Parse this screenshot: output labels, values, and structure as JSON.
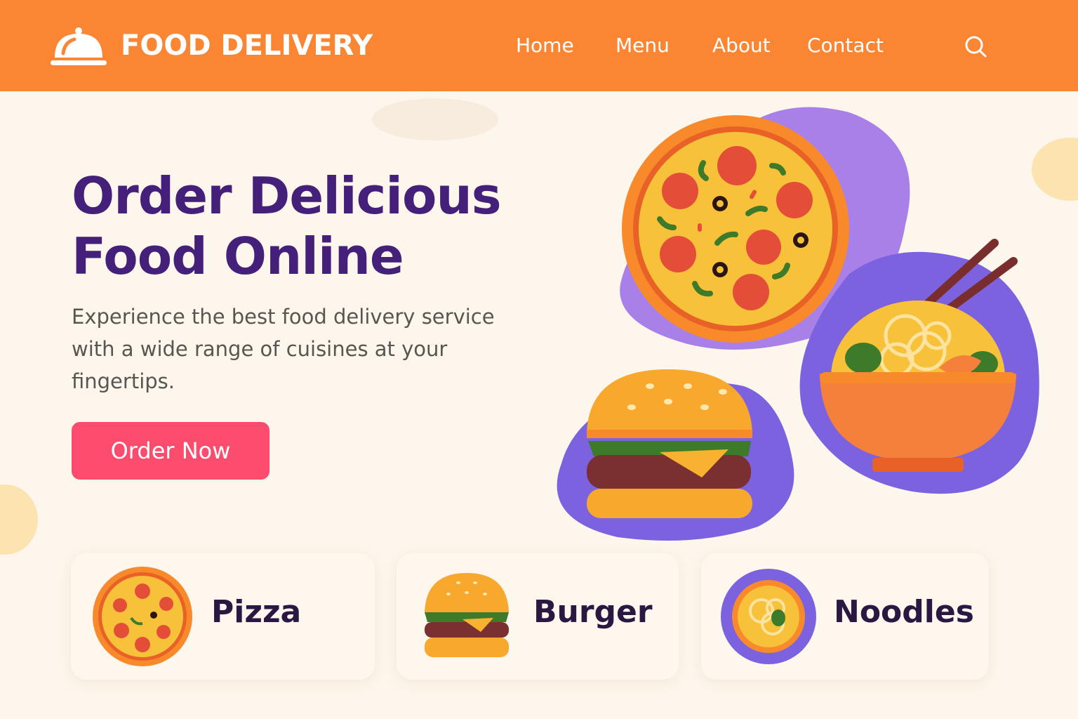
{
  "brand": {
    "name": "FOOD DELIVERY",
    "logo_icon": "cloche-icon"
  },
  "nav": {
    "items": [
      "Home",
      "Menu",
      "About",
      "Contact"
    ],
    "search_icon": "search-icon"
  },
  "hero": {
    "title_line1": "Order Delicious",
    "title_line2": "Food Online",
    "subtitle": "Experience the best food delivery service with a wide range of cuisines at your fingertips.",
    "cta_label": "Order Now"
  },
  "categories": [
    {
      "label": "Pizza",
      "icon": "pizza-icon"
    },
    {
      "label": "Burger",
      "icon": "burger-icon"
    },
    {
      "label": "Noodles",
      "icon": "noodles-icon"
    }
  ],
  "colors": {
    "header": "#fa8532",
    "title": "#44207a",
    "cta": "#fb4c6e",
    "background": "#fcf6ec",
    "accent_purple": "#7d62e0"
  }
}
